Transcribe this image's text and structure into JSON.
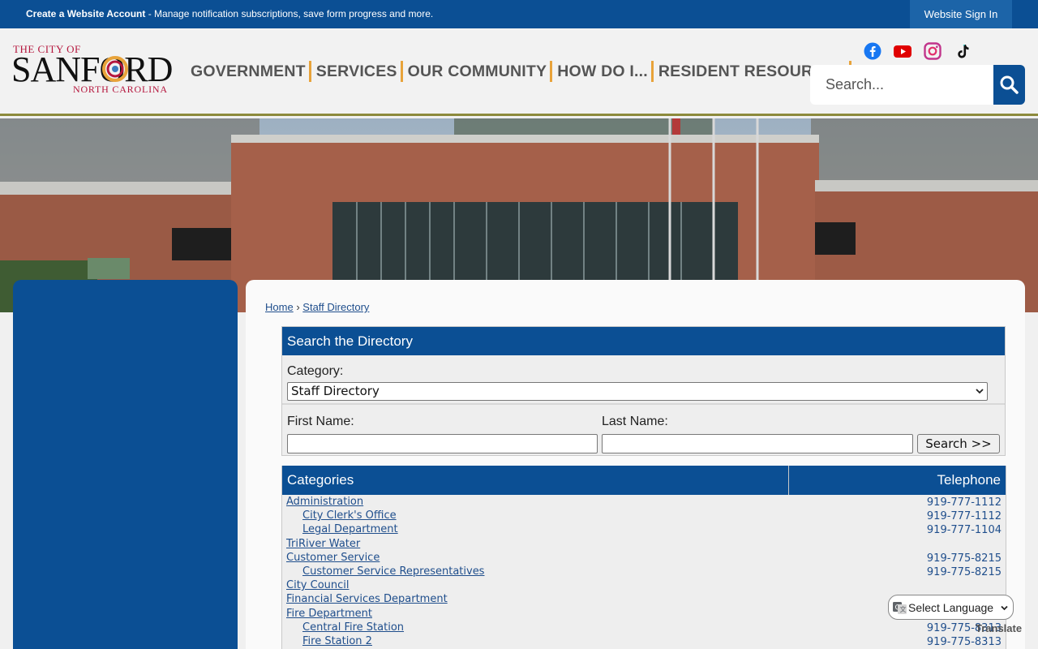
{
  "topbar": {
    "account_link": "Create a Website Account",
    "account_desc": " - Manage notification subscriptions, save form progress and more.",
    "sign_in": "Website Sign In"
  },
  "logo": {
    "line1": "THE CITY OF",
    "line2": "SANFORD",
    "line3": "NORTH CAROLINA"
  },
  "nav": [
    "GOVERNMENT",
    "SERVICES",
    "OUR COMMUNITY",
    "HOW DO I...",
    "RESIDENT RESOURCES"
  ],
  "social": [
    "facebook-icon",
    "youtube-icon",
    "instagram-icon",
    "tiktok-icon"
  ],
  "search": {
    "placeholder": "Search..."
  },
  "breadcrumb": {
    "home": "Home",
    "separator": "›",
    "current": "Staff Directory"
  },
  "directory": {
    "title": "Search the Directory",
    "category_label": "Category:",
    "category_value": "Staff Directory",
    "first_name_label": "First Name:",
    "last_name_label": "Last Name:",
    "search_button": "Search >>"
  },
  "table": {
    "col_categories": "Categories",
    "col_telephone": "Telephone",
    "rows": [
      {
        "name": "Administration",
        "phone": "919-777-1112",
        "indent": false
      },
      {
        "name": "City Clerk's Office",
        "phone": "919-777-1112",
        "indent": true
      },
      {
        "name": "Legal Department",
        "phone": "919-777-1104",
        "indent": true
      },
      {
        "name": "TriRiver Water",
        "phone": "",
        "indent": false
      },
      {
        "name": "Customer Service",
        "phone": "919-775-8215",
        "indent": false
      },
      {
        "name": "Customer Service Representatives",
        "phone": "919-775-8215",
        "indent": true
      },
      {
        "name": "City Council",
        "phone": "",
        "indent": false
      },
      {
        "name": "Financial Services Department",
        "phone": "",
        "indent": false
      },
      {
        "name": "Fire Department",
        "phone": "",
        "indent": false
      },
      {
        "name": "Central Fire Station",
        "phone": "919-775-8313",
        "indent": true
      },
      {
        "name": "Fire Station 2",
        "phone": "919-775-8313",
        "indent": true
      }
    ]
  },
  "translate": {
    "label": "Select Language",
    "powered": "Translate"
  },
  "colors": {
    "primary": "#0b4f94",
    "accent": "#e8a33a",
    "link": "#1f4e8c"
  }
}
